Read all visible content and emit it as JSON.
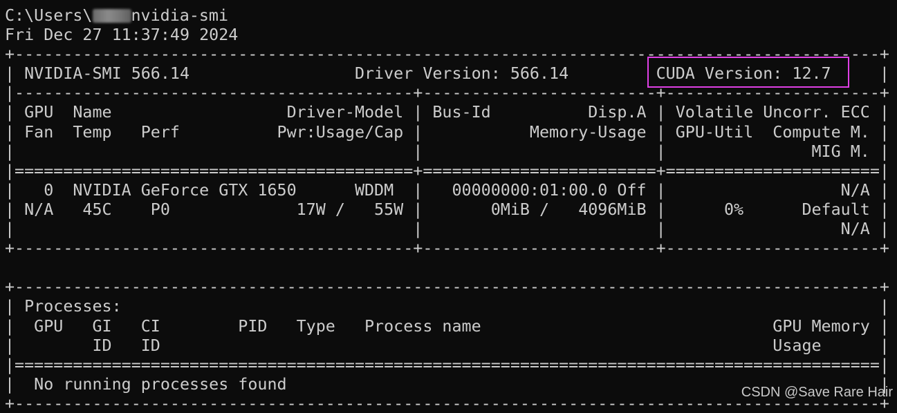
{
  "prompt": {
    "path_before": "C:\\Users\\",
    "redacted_username": "",
    "command": "nvidia-smi"
  },
  "timestamp": "Fri Dec 27 11:37:49 2024",
  "table": {
    "rule_top": "+-----------------------------------------------------------------------------------------+",
    "header_smi": "| NVIDIA-SMI 566.14                 Driver Version: 566.14         CUDA Version: 12.7     |",
    "rule_split": "|-----------------------------------------+------------------------+----------------------+",
    "col_row1": "| GPU  Name                  Driver-Model | Bus-Id          Disp.A | Volatile Uncorr. ECC |",
    "col_row2": "| Fan  Temp   Perf          Pwr:Usage/Cap |           Memory-Usage | GPU-Util  Compute M. |",
    "col_row3": "|                                         |                        |               MIG M. |",
    "rule_double": "|=========================================+========================+======================|",
    "gpu_row1": "|   0  NVIDIA GeForce GTX 1650      WDDM  |   00000000:01:00.0 Off |                  N/A |",
    "gpu_row2": "| N/A   45C    P0             17W /   55W |       0MiB /   4096MiB |      0%      Default |",
    "gpu_row3": "|                                         |                        |                  N/A |",
    "rule_bottom": "+-----------------------------------------+------------------------+----------------------+"
  },
  "processes": {
    "rule_top": "+-----------------------------------------------------------------------------------------+",
    "title": "| Processes:                                                                              |",
    "header1": "|  GPU   GI   CI        PID   Type   Process name                              GPU Memory |",
    "header2": "|        ID   ID                                                               Usage      |",
    "rule_double": "|=========================================================================================|",
    "none": "|  No running processes found                                                             |",
    "rule_bottom": "+-----------------------------------------------------------------------------------------+"
  },
  "watermark": "CSDN @Save Rare Hair",
  "colors": {
    "background": "#0c0c0c",
    "text": "#cccccc",
    "highlight_box": "#e040e6"
  }
}
